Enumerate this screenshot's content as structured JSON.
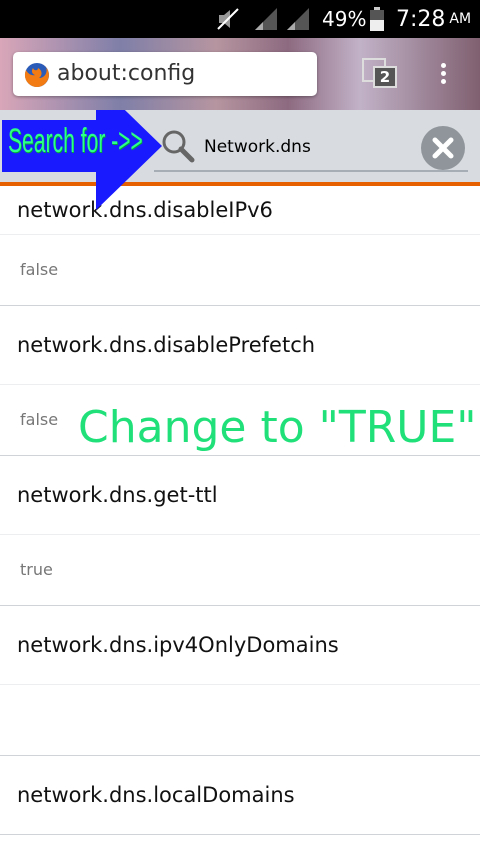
{
  "status_bar": {
    "battery_percent": "49%",
    "time": "7:28",
    "am_pm": "AM",
    "icons": [
      "mute-icon",
      "signal-icon",
      "signal-icon",
      "battery-icon"
    ]
  },
  "browser": {
    "url": "about:config",
    "tab_count": "2",
    "accent_color": "#e66000"
  },
  "search": {
    "value": "Network.dns",
    "placeholder": ""
  },
  "prefs": [
    {
      "name": "network.dns.disableIPv6",
      "value": "false"
    },
    {
      "name": "network.dns.disablePrefetch",
      "value": "false"
    },
    {
      "name": "network.dns.get-ttl",
      "value": "true"
    },
    {
      "name": "network.dns.ipv4OnlyDomains",
      "value": ""
    },
    {
      "name": "network.dns.localDomains",
      "value": ""
    }
  ],
  "annotations": {
    "search_for": "Search for ->>",
    "change_to": "Change to \"TRUE\"",
    "arrow_color": "#1a1aff",
    "text_color": "#22e87e"
  }
}
